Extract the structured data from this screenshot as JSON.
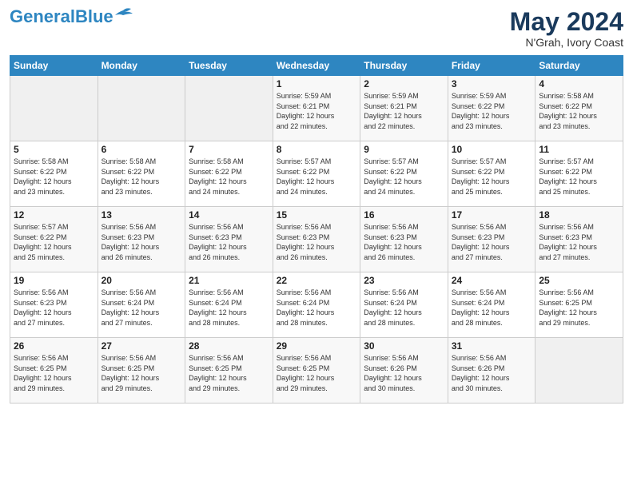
{
  "header": {
    "logo_line1": "General",
    "logo_line2": "Blue",
    "month": "May 2024",
    "location": "N'Grah, Ivory Coast"
  },
  "weekdays": [
    "Sunday",
    "Monday",
    "Tuesday",
    "Wednesday",
    "Thursday",
    "Friday",
    "Saturday"
  ],
  "weeks": [
    [
      {
        "day": "",
        "info": ""
      },
      {
        "day": "",
        "info": ""
      },
      {
        "day": "",
        "info": ""
      },
      {
        "day": "1",
        "info": "Sunrise: 5:59 AM\nSunset: 6:21 PM\nDaylight: 12 hours\nand 22 minutes."
      },
      {
        "day": "2",
        "info": "Sunrise: 5:59 AM\nSunset: 6:21 PM\nDaylight: 12 hours\nand 22 minutes."
      },
      {
        "day": "3",
        "info": "Sunrise: 5:59 AM\nSunset: 6:22 PM\nDaylight: 12 hours\nand 23 minutes."
      },
      {
        "day": "4",
        "info": "Sunrise: 5:58 AM\nSunset: 6:22 PM\nDaylight: 12 hours\nand 23 minutes."
      }
    ],
    [
      {
        "day": "5",
        "info": "Sunrise: 5:58 AM\nSunset: 6:22 PM\nDaylight: 12 hours\nand 23 minutes."
      },
      {
        "day": "6",
        "info": "Sunrise: 5:58 AM\nSunset: 6:22 PM\nDaylight: 12 hours\nand 23 minutes."
      },
      {
        "day": "7",
        "info": "Sunrise: 5:58 AM\nSunset: 6:22 PM\nDaylight: 12 hours\nand 24 minutes."
      },
      {
        "day": "8",
        "info": "Sunrise: 5:57 AM\nSunset: 6:22 PM\nDaylight: 12 hours\nand 24 minutes."
      },
      {
        "day": "9",
        "info": "Sunrise: 5:57 AM\nSunset: 6:22 PM\nDaylight: 12 hours\nand 24 minutes."
      },
      {
        "day": "10",
        "info": "Sunrise: 5:57 AM\nSunset: 6:22 PM\nDaylight: 12 hours\nand 25 minutes."
      },
      {
        "day": "11",
        "info": "Sunrise: 5:57 AM\nSunset: 6:22 PM\nDaylight: 12 hours\nand 25 minutes."
      }
    ],
    [
      {
        "day": "12",
        "info": "Sunrise: 5:57 AM\nSunset: 6:22 PM\nDaylight: 12 hours\nand 25 minutes."
      },
      {
        "day": "13",
        "info": "Sunrise: 5:56 AM\nSunset: 6:23 PM\nDaylight: 12 hours\nand 26 minutes."
      },
      {
        "day": "14",
        "info": "Sunrise: 5:56 AM\nSunset: 6:23 PM\nDaylight: 12 hours\nand 26 minutes."
      },
      {
        "day": "15",
        "info": "Sunrise: 5:56 AM\nSunset: 6:23 PM\nDaylight: 12 hours\nand 26 minutes."
      },
      {
        "day": "16",
        "info": "Sunrise: 5:56 AM\nSunset: 6:23 PM\nDaylight: 12 hours\nand 26 minutes."
      },
      {
        "day": "17",
        "info": "Sunrise: 5:56 AM\nSunset: 6:23 PM\nDaylight: 12 hours\nand 27 minutes."
      },
      {
        "day": "18",
        "info": "Sunrise: 5:56 AM\nSunset: 6:23 PM\nDaylight: 12 hours\nand 27 minutes."
      }
    ],
    [
      {
        "day": "19",
        "info": "Sunrise: 5:56 AM\nSunset: 6:23 PM\nDaylight: 12 hours\nand 27 minutes."
      },
      {
        "day": "20",
        "info": "Sunrise: 5:56 AM\nSunset: 6:24 PM\nDaylight: 12 hours\nand 27 minutes."
      },
      {
        "day": "21",
        "info": "Sunrise: 5:56 AM\nSunset: 6:24 PM\nDaylight: 12 hours\nand 28 minutes."
      },
      {
        "day": "22",
        "info": "Sunrise: 5:56 AM\nSunset: 6:24 PM\nDaylight: 12 hours\nand 28 minutes."
      },
      {
        "day": "23",
        "info": "Sunrise: 5:56 AM\nSunset: 6:24 PM\nDaylight: 12 hours\nand 28 minutes."
      },
      {
        "day": "24",
        "info": "Sunrise: 5:56 AM\nSunset: 6:24 PM\nDaylight: 12 hours\nand 28 minutes."
      },
      {
        "day": "25",
        "info": "Sunrise: 5:56 AM\nSunset: 6:25 PM\nDaylight: 12 hours\nand 29 minutes."
      }
    ],
    [
      {
        "day": "26",
        "info": "Sunrise: 5:56 AM\nSunset: 6:25 PM\nDaylight: 12 hours\nand 29 minutes."
      },
      {
        "day": "27",
        "info": "Sunrise: 5:56 AM\nSunset: 6:25 PM\nDaylight: 12 hours\nand 29 minutes."
      },
      {
        "day": "28",
        "info": "Sunrise: 5:56 AM\nSunset: 6:25 PM\nDaylight: 12 hours\nand 29 minutes."
      },
      {
        "day": "29",
        "info": "Sunrise: 5:56 AM\nSunset: 6:25 PM\nDaylight: 12 hours\nand 29 minutes."
      },
      {
        "day": "30",
        "info": "Sunrise: 5:56 AM\nSunset: 6:26 PM\nDaylight: 12 hours\nand 30 minutes."
      },
      {
        "day": "31",
        "info": "Sunrise: 5:56 AM\nSunset: 6:26 PM\nDaylight: 12 hours\nand 30 minutes."
      },
      {
        "day": "",
        "info": ""
      }
    ]
  ]
}
